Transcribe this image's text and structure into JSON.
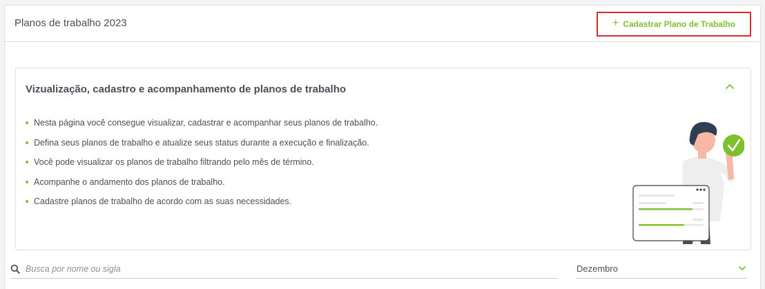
{
  "header": {
    "title": "Planos de trabalho 2023",
    "add_button_label": "Cadastrar Plano de Trabalho"
  },
  "info": {
    "title": "Vizualização, cadastro e acompanhamento de planos de trabalho",
    "bullets": [
      "Nesta página você consegue visualizar, cadastrar e acompanhar seus planos de trabalho.",
      "Defina seus planos de trabalho e atualize seus status durante a execução e finalização.",
      "Você pode visualizar os planos de trabalho filtrando pelo mês de término.",
      "Acompanhe o andamento dos planos de trabalho.",
      "Cadastre planos de trabalho de acordo com as suas necessidades."
    ]
  },
  "search": {
    "placeholder": "Busca por nome ou sigla",
    "value": ""
  },
  "filter": {
    "month": "Dezembro"
  },
  "colors": {
    "accent": "#7cc02e",
    "highlight_border": "#d62b2b",
    "text": "#4a4f57"
  },
  "icons": {
    "add": "plus-icon",
    "collapse": "chevron-up-icon",
    "search": "search-icon",
    "select": "chevron-down-icon"
  }
}
